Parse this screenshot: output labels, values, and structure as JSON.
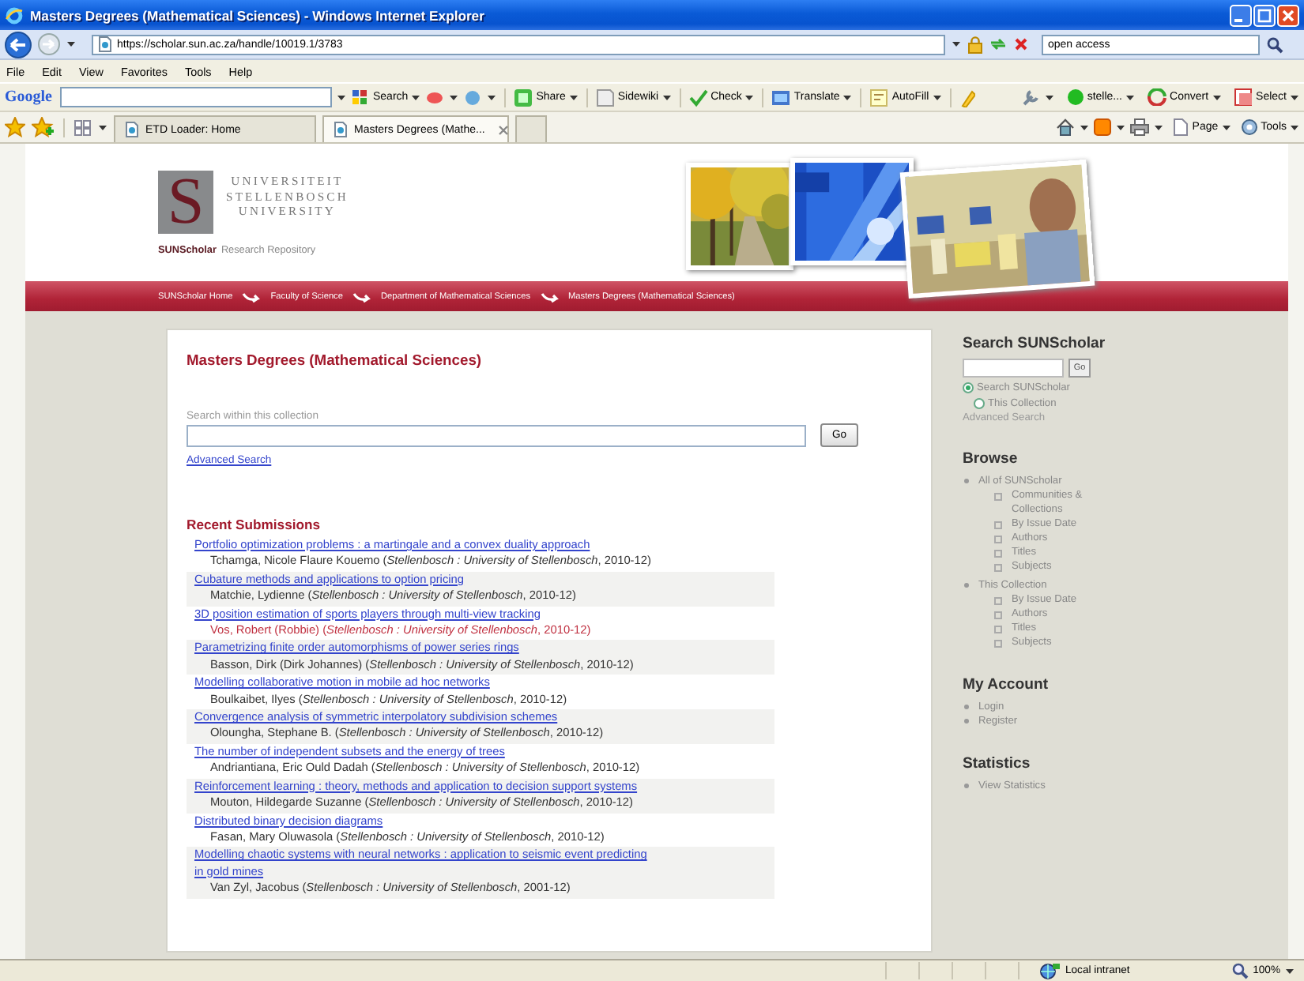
{
  "window": {
    "title": "Masters Degrees (Mathematical Sciences) - Windows Internet Explorer"
  },
  "address_bar": {
    "url": "https://scholar.sun.ac.za/handle/10019.1/3783",
    "search_value": "open access"
  },
  "menu": [
    "File",
    "Edit",
    "View",
    "Favorites",
    "Tools",
    "Help"
  ],
  "google_toolbar": {
    "logo": "Google",
    "left_items": [
      "Search",
      "Share",
      "Sidewiki",
      "Check",
      "Translate",
      "AutoFill"
    ],
    "right_items": [
      "stelle...",
      "Convert",
      "Select"
    ]
  },
  "tabs": [
    {
      "label": "ETD Loader: Home",
      "selected": false
    },
    {
      "label": "Masters Degrees (Mathe...",
      "selected": true
    }
  ],
  "command_bar": [
    "Page",
    "Tools"
  ],
  "site": {
    "logo_letter": "S",
    "university": [
      "UNIVERSITEIT",
      "STELLENBOSCH",
      "UNIVERSITY"
    ],
    "repository_name": "SUNScholar",
    "repository_tagline": "Research Repository",
    "pictures": [
      {
        "kind": "picture"
      },
      {
        "kind": "picture"
      },
      {
        "kind": "picture"
      }
    ]
  },
  "breadcrumbs": [
    "SUNScholar Home",
    "Faculty of Science",
    "Department of Mathematical Sciences",
    "Masters Degrees (Mathematical Sciences)"
  ],
  "collection": {
    "title": "Masters Degrees (Mathematical Sciences)",
    "search_label": "Search within this collection",
    "go_button": "Go",
    "advanced_search": "Advanced Search"
  },
  "recent_submissions": {
    "heading": "Recent Submissions",
    "items": [
      {
        "title": "Portfolio optimization problems : a martingale and a convex duality approach",
        "author": "Tchamga, Nicole Flaure Kouemo (*Stellenbosch : University of Stellenbosch*, 2010-12)",
        "hovered": false
      },
      {
        "title": "Cubature methods and applications to option pricing",
        "author": "Matchie, Lydienne (*Stellenbosch : University of Stellenbosch*, 2010-12)",
        "hovered": false
      },
      {
        "title": "3D position estimation of sports players through multi-view tracking",
        "author": "Vos, Robert (Robbie) (*Stellenbosch : University of Stellenbosch*, 2010-12)",
        "hovered": true
      },
      {
        "title": "Parametrizing finite order automorphisms of power series rings",
        "author": "Basson, Dirk (Dirk Johannes) (*Stellenbosch : University of Stellenbosch*, 2010-12)",
        "hovered": false
      },
      {
        "title": "Modelling collaborative motion in mobile ad hoc networks",
        "author": "Boulkaibet, Ilyes (*Stellenbosch : University of Stellenbosch*, 2010-12)",
        "hovered": false
      },
      {
        "title": "Convergence analysis of symmetric interpolatory subdivision schemes",
        "author": "Oloungha, Stephane B. (*Stellenbosch : University of Stellenbosch*, 2010-12)",
        "hovered": false
      },
      {
        "title": "The number of independent subsets and the energy of trees",
        "author": "Andriantiana, Eric Ould Dadah (*Stellenbosch : University of Stellenbosch*, 2010-12)",
        "hovered": false
      },
      {
        "title": "Reinforcement learning : theory, methods and application to decision support systems",
        "author": "Mouton, Hildegarde Suzanne (*Stellenbosch : University of Stellenbosch*, 2010-12)",
        "hovered": false
      },
      {
        "title": "Distributed binary decision diagrams",
        "author": "Fasan, Mary Oluwasola (*Stellenbosch : University of Stellenbosch*, 2010-12)",
        "hovered": false
      },
      {
        "title": "Modelling chaotic systems with neural networks : application to seismic event predicting in gold mines",
        "author": "Van Zyl, Jacobus (*Stellenbosch : University of Stellenbosch*, 2001-12)",
        "hovered": false
      }
    ]
  },
  "sidebar": {
    "search": {
      "heading": "Search SUNScholar",
      "go_button": "Go",
      "scopes": [
        {
          "label": "Search SUNScholar",
          "selected": true
        },
        {
          "label": "This Collection",
          "selected": false
        }
      ],
      "advanced_search": "Advanced Search"
    },
    "browse": {
      "heading": "Browse",
      "groups": [
        {
          "label": "All of SUNScholar",
          "children": [
            {
              "label": "Communities & Collections"
            },
            {
              "label": "By Issue Date"
            },
            {
              "label": "Authors"
            },
            {
              "label": "Titles"
            },
            {
              "label": "Subjects"
            }
          ]
        },
        {
          "label": "This Collection",
          "children": [
            {
              "label": "By Issue Date"
            },
            {
              "label": "Authors"
            },
            {
              "label": "Titles"
            },
            {
              "label": "Subjects"
            }
          ]
        }
      ]
    },
    "my_account": {
      "heading": "My Account",
      "items": [
        "Login",
        "Register"
      ]
    },
    "statistics": {
      "heading": "Statistics",
      "items": [
        "View Statistics"
      ]
    }
  },
  "status_bar": {
    "zone": "Local intranet",
    "zoom": "100%"
  }
}
